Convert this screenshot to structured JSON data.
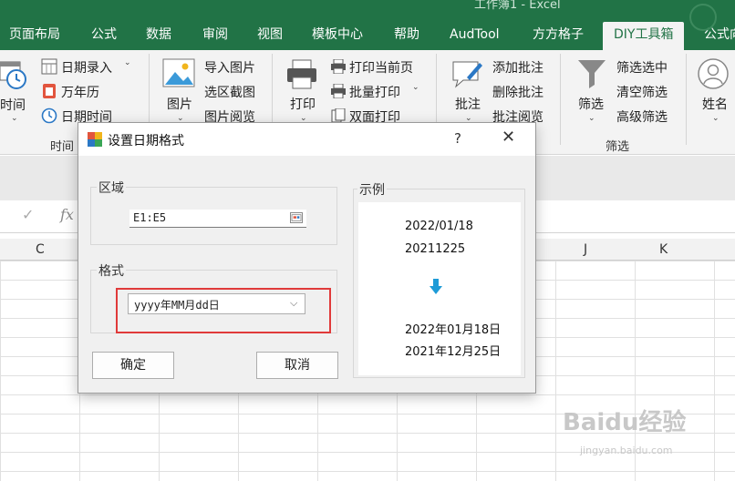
{
  "window_title": "工作簿1 - Excel",
  "tabs": [
    "页面布局",
    "公式",
    "数据",
    "审阅",
    "视图",
    "模板中心",
    "帮助",
    "AudTool",
    "方方格子",
    "DIY工具箱",
    "公式向"
  ],
  "ribbon": {
    "time_btn": "时间",
    "date_entry": "日期录入",
    "calendar": "万年历",
    "datetime": "日期时间",
    "time_group": "时间",
    "picture_btn": "图片",
    "import_picture": "导入图片",
    "region_capture": "选区截图",
    "picture_browse": "图片阅览",
    "print_btn": "打印",
    "print_current": "打印当前页",
    "batch_print": "批量打印",
    "duplex_print": "双面打印",
    "comment_btn": "批注",
    "add_comment": "添加批注",
    "delete_comment": "删除批注",
    "comment_browse": "批注阅览",
    "filter_btn": "筛选",
    "filter_selected": "筛选选中",
    "clear_filter": "清空筛选",
    "advanced_filter": "高级筛选",
    "filter_group": "筛选",
    "name_btn": "姓名"
  },
  "formula_bar": {
    "check": "✓",
    "fx": "fx"
  },
  "columns": {
    "c": "C",
    "j": "J",
    "k": "K"
  },
  "dialog": {
    "title": "设置日期格式",
    "help": "?",
    "close": "✕",
    "range_legend": "区域",
    "range_value": "E1:E5",
    "format_legend": "格式",
    "format_value": "yyyy年MM月dd日",
    "example_legend": "示例",
    "examples_before": [
      "2022/01/18",
      "20211225"
    ],
    "examples_after": [
      "2022年01月18日",
      "2021年12月25日"
    ],
    "ok": "确定",
    "cancel": "取消"
  },
  "watermark": {
    "main": "Baidu经验",
    "sub": "jingyan.baidu.com"
  },
  "colors": {
    "excel_green": "#217346",
    "highlight_red": "#e03a3a",
    "arrow_blue": "#1e9bd7"
  }
}
